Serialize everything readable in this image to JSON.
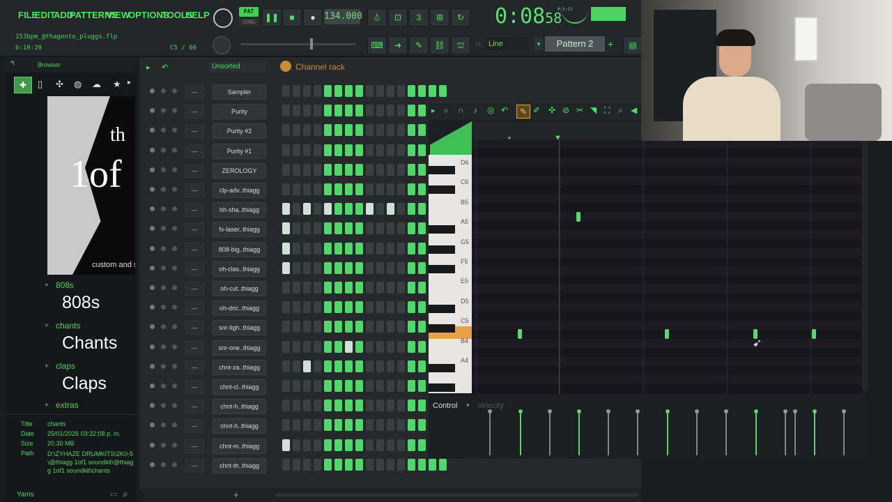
{
  "menu": [
    "FILE",
    "EDIT",
    "ADD",
    "PATTERNS",
    "VIEW",
    "OPTIONS",
    "TOOLS",
    "HELP"
  ],
  "transport": {
    "mode_label": "PAT",
    "song_label": "SONG",
    "tempo": "134.000",
    "time_main": "0:08",
    "time_sub": "58",
    "time_unit": "M:S:CS"
  },
  "project": {
    "file": "153bpm_@thagonto_pluggs.flp",
    "time": "6:10:20",
    "note_info": "C5 / 60"
  },
  "snap": {
    "value": "Line"
  },
  "pattern": {
    "name": "Pattern 2"
  },
  "browser": {
    "tab": "Browser",
    "categories": [
      {
        "small": "808s",
        "big": "808s"
      },
      {
        "small": "chants",
        "big": "Chants"
      },
      {
        "small": "claps",
        "big": "Claps"
      },
      {
        "small": "extras",
        "big": ""
      }
    ],
    "art_text_1": "1of",
    "art_text_2": "th",
    "art_caption": "custom and sta",
    "info": {
      "title_k": "Title",
      "title_v": "chants",
      "date_k": "Date",
      "date_v": "25/01/2026 03:32:08 p. m.",
      "size_k": "Size",
      "size_v": "20.30 MB",
      "path_k": "Path",
      "path_v": "D:\\ZYHAZE DRUMKITS\\2K0-5\\@thiagg 1of1 soundkit\\@thiagg 1of1 soundkit\\chants"
    },
    "footer": "Yams"
  },
  "rack": {
    "filter": "Unsorted",
    "title": "Channel rack",
    "channels": [
      "Sampler",
      "Purity",
      "Purity #2",
      "Purity #1",
      "ZEROLOGY",
      "clp-adv..thiagg",
      "hh-sha..thiagg",
      "fx-laser..thiagg",
      "808-big..thiagg",
      "oh-clas..thiagg",
      "oh-cut..thiagg",
      "oh-dric..thiagg",
      "snr-ligh..thiagg",
      "snr-one..thiagg",
      "chnt-za..thiagg",
      "chnt-cl..thiagg",
      "chnt-h..thiagg",
      "chnt-h..thiagg",
      "chnt-m..thiagg",
      "chnt-th..thiagg"
    ]
  },
  "piano_roll": {
    "keys": [
      "D6",
      "C6",
      "B5",
      "A5",
      "G5",
      "F5",
      "E5",
      "D5",
      "C5",
      "B4",
      "A4"
    ],
    "control_label": "Control",
    "velocity_label": "Velocity"
  },
  "colors": {
    "accent": "#4be364",
    "step_on": "#51d86b",
    "background": "#1a1d1f",
    "highlight_key": "#e8a04a"
  }
}
